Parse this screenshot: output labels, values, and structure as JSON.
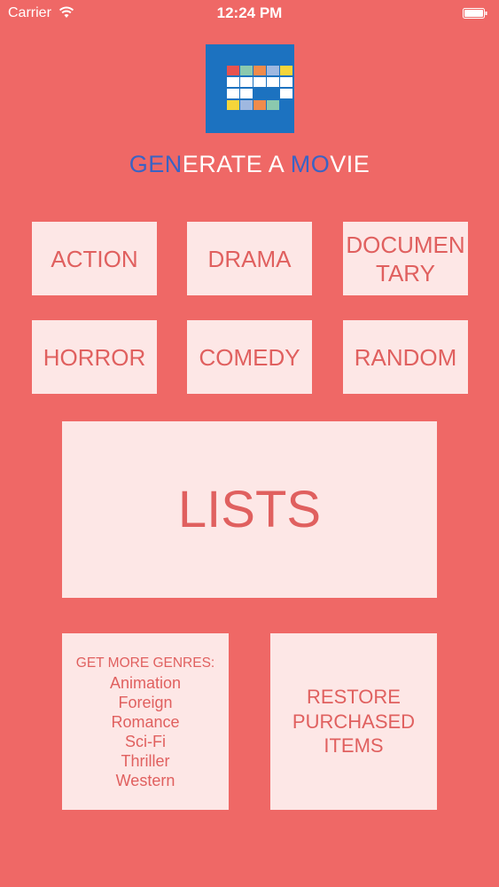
{
  "status_bar": {
    "carrier": "Carrier",
    "time": "12:24 PM",
    "wifi_icon": "wifi-icon",
    "battery_icon": "battery-icon"
  },
  "logo": {
    "icon": "generate-a-movie-logo",
    "background": "#1c72c0",
    "cell_colors": [
      "#e8524f",
      "#8bc9ae",
      "#f08b4b",
      "#9fb8e0",
      "#f5d53a",
      "#ffffff"
    ]
  },
  "title": {
    "part1": "GEN",
    "part2": "ERATE A ",
    "part3": "MO",
    "part4": "VIE"
  },
  "genres": {
    "action": "ACTION",
    "drama": "DRAMA",
    "documentary_line1": "DOCUMEN",
    "documentary_line2": "TARY",
    "horror": "HORROR",
    "comedy": "COMEDY",
    "random": "RANDOM"
  },
  "lists_label": "LISTS",
  "more_genres": {
    "heading": "GET MORE GENRES:",
    "items": [
      "Animation",
      "Foreign",
      "Romance",
      "Sci-Fi",
      "Thriller",
      "Western"
    ]
  },
  "restore": {
    "line1": "RESTORE",
    "line2": "PURCHASED",
    "line3": "ITEMS"
  },
  "colors": {
    "background": "#ef6866",
    "tile": "#fde7e6",
    "tile_text": "#e0605f",
    "title_accent": "#3a63c4"
  }
}
